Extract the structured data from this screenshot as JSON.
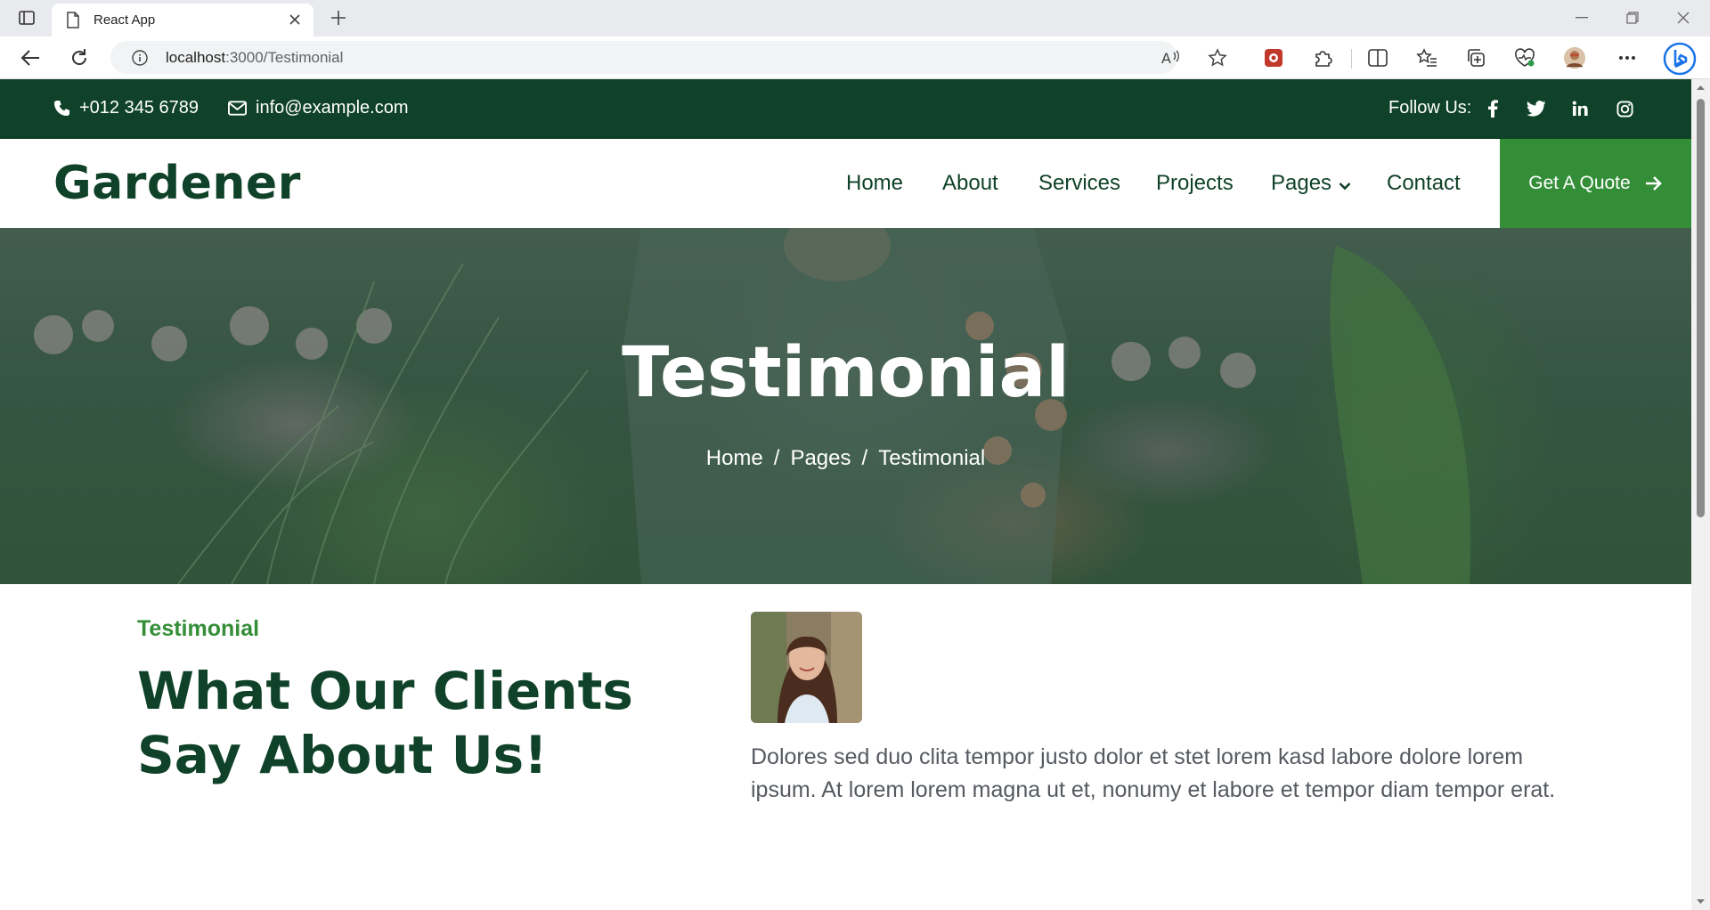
{
  "browser": {
    "tab_title": "React App",
    "url_host": "localhost",
    "url_path": ":3000/Testimonial"
  },
  "topbar": {
    "phone": "+012 345 6789",
    "email": "info@example.com",
    "follow_label": "Follow Us:",
    "social_icons": [
      "facebook-icon",
      "twitter-icon",
      "linkedin-icon",
      "instagram-icon"
    ]
  },
  "navbar": {
    "logo": "Gardener",
    "items": [
      "Home",
      "About",
      "Services",
      "Projects",
      "Pages",
      "Contact"
    ],
    "quote_button": "Get A Quote"
  },
  "hero": {
    "title": "Testimonial",
    "breadcrumb": [
      "Home",
      "Pages",
      "Testimonial"
    ],
    "breadcrumb_separator": "/"
  },
  "testimonial": {
    "subtitle": "Testimonial",
    "heading": "What Our Clients Say About Us!",
    "quote": "Dolores sed duo clita tempor justo dolor et stet lorem kasd labore dolore lorem ipsum. At lorem lorem magna ut et, nonumy et labore et tempor diam tempor erat."
  },
  "colors": {
    "dark_green": "#0f4228",
    "accent_green": "#348e38",
    "text_gray": "#555a60"
  }
}
